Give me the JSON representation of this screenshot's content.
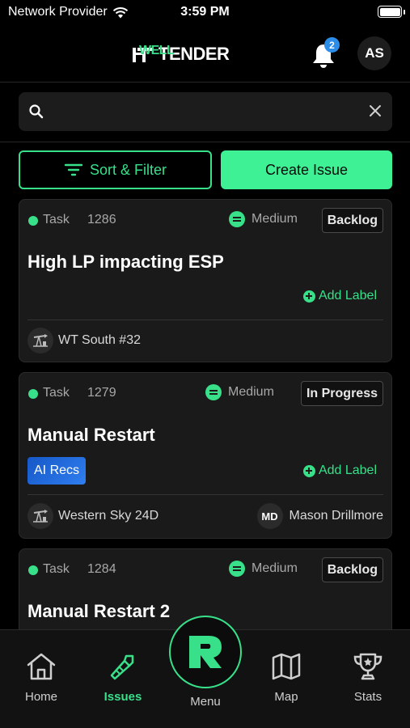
{
  "status_bar": {
    "carrier": "Network Provider",
    "time": "3:59 PM",
    "battery_level": 1.0
  },
  "header": {
    "logo_well": "WELL",
    "logo_tender": "TENDER",
    "notification_count": "2",
    "user_initials": "AS"
  },
  "search": {
    "value": "",
    "placeholder": ""
  },
  "actions": {
    "sort_filter_label": "Sort & Filter",
    "create_issue_label": "Create Issue"
  },
  "issues": [
    {
      "type": "Task",
      "number": "1286",
      "priority": "Medium",
      "status": "Backlog",
      "title": "High LP impacting ESP",
      "add_label": "Add Label",
      "well": "WT South #32"
    },
    {
      "type": "Task",
      "number": "1279",
      "priority": "Medium",
      "status": "In Progress",
      "title": "Manual Restart",
      "tag": "AI Recs",
      "add_label": "Add Label",
      "well": "Western Sky 24D",
      "assignee_initials": "MD",
      "assignee_name": "Mason Drillmore"
    },
    {
      "type": "Task",
      "number": "1284",
      "priority": "Medium",
      "status": "Backlog",
      "title": "Manual Restart 2"
    }
  ],
  "nav": {
    "home": "Home",
    "issues": "Issues",
    "menu": "Menu",
    "map": "Map",
    "stats": "Stats"
  },
  "colors": {
    "accent": "#38e08a",
    "create_button": "#3ef195",
    "badge_blue": "#2c8de8",
    "background": "#000000",
    "card": "#1a1a1a"
  }
}
